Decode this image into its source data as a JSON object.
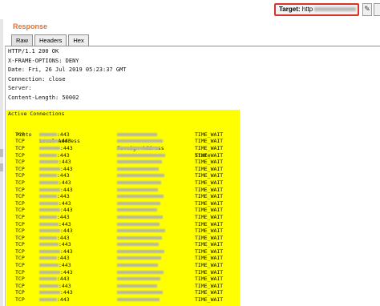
{
  "target": {
    "label": "Target:",
    "value": "http"
  },
  "edit_icon": "pencil-icon",
  "response": {
    "title": "Response",
    "tabs": [
      {
        "label": "Raw"
      },
      {
        "label": "Headers"
      },
      {
        "label": "Hex"
      }
    ],
    "active_tab": "Raw",
    "headers": [
      "HTTP/1.1 200 OK",
      "X-FRAME-OPTIONS: DENY",
      "Date: Fri, 26 Jul 2019 05:23:37 GMT",
      "Connection: close",
      "Server:",
      "Content-Length: 50002"
    ],
    "body": {
      "heading": "Active Connections",
      "columns": [
        "Proto",
        "Local Address",
        "Foreign Address",
        "State"
      ],
      "rows": [
        {
          "proto": "TCP",
          "local_port": ":443",
          "state": "TIME_WAIT"
        },
        {
          "proto": "TCP",
          "local_port": ":443",
          "state": "TIME_WAIT"
        },
        {
          "proto": "TCP",
          "local_port": ":443",
          "state": "TIME_WAIT"
        },
        {
          "proto": "TCP",
          "local_port": ":443",
          "state": "TIME_WAIT"
        },
        {
          "proto": "TCP",
          "local_port": ":443",
          "state": "TIME_WAIT"
        },
        {
          "proto": "TCP",
          "local_port": ":443",
          "state": "TIME_WAIT"
        },
        {
          "proto": "TCP",
          "local_port": ":443",
          "state": "TIME_WAIT"
        },
        {
          "proto": "TCP",
          "local_port": ":443",
          "state": "TIME_WAIT"
        },
        {
          "proto": "TCP",
          "local_port": ":443",
          "state": "TIME_WAIT"
        },
        {
          "proto": "TCP",
          "local_port": ":443",
          "state": "TIME_WAIT"
        },
        {
          "proto": "TCP",
          "local_port": ":443",
          "state": "TIME_WAIT"
        },
        {
          "proto": "TCP",
          "local_port": ":443",
          "state": "TIME_WAIT"
        },
        {
          "proto": "TCP",
          "local_port": ":443",
          "state": "TIME_WAIT"
        },
        {
          "proto": "TCP",
          "local_port": ":443",
          "state": "TIME_WAIT"
        },
        {
          "proto": "TCP",
          "local_port": ":443",
          "state": "TIME_WAIT"
        },
        {
          "proto": "TCP",
          "local_port": ":443",
          "state": "TIME_WAIT"
        },
        {
          "proto": "TCP",
          "local_port": ":443",
          "state": "TIME_WAIT"
        },
        {
          "proto": "TCP",
          "local_port": ":443",
          "state": "TIME_WAIT"
        },
        {
          "proto": "TCP",
          "local_port": ":443",
          "state": "TIME_WAIT"
        },
        {
          "proto": "TCP",
          "local_port": ":443",
          "state": "TIME_WAIT"
        },
        {
          "proto": "TCP",
          "local_port": ":443",
          "state": "TIME_WAIT"
        },
        {
          "proto": "TCP",
          "local_port": ":443",
          "state": "TIME_WAIT"
        },
        {
          "proto": "TCP",
          "local_port": ":443",
          "state": "TIME_WAIT"
        },
        {
          "proto": "TCP",
          "local_port": ":443",
          "state": "TIME_WAIT"
        },
        {
          "proto": "TCP",
          "local_port": ":443",
          "state": "TIME_WAIT"
        }
      ]
    }
  },
  "colors": {
    "title": "#e8702a",
    "highlight": "#ffff00",
    "target_border": "#d9322a"
  }
}
